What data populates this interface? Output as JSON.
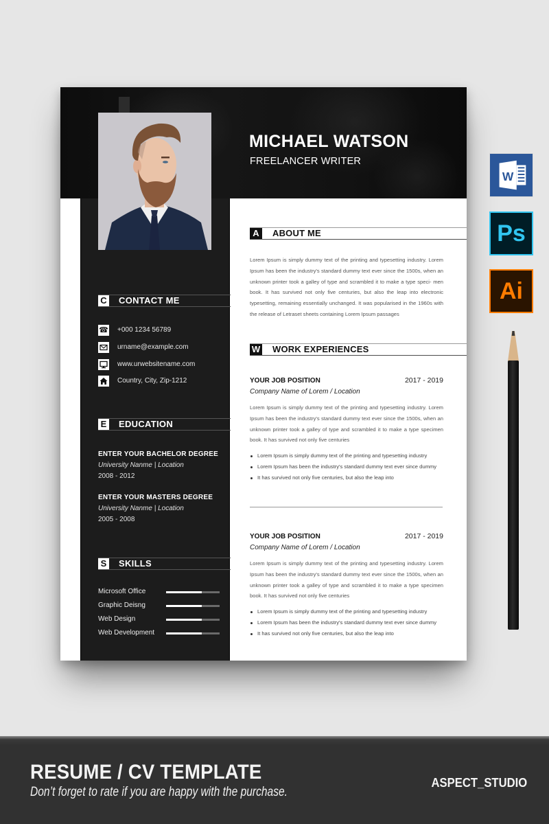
{
  "resume": {
    "name": "MICHAEL WATSON",
    "title": "FREELANCER WRITER",
    "contact": {
      "letter": "C",
      "heading": "CONTACT ME",
      "items": [
        {
          "icon": "phone-icon",
          "text": "+000 1234 56789"
        },
        {
          "icon": "envelope-icon",
          "text": "urname@example.com"
        },
        {
          "icon": "monitor-icon",
          "text": "www.urwebsitename.com"
        },
        {
          "icon": "home-icon",
          "text": "Country, City, Zip-1212"
        }
      ]
    },
    "education": {
      "letter": "E",
      "heading": "EDUCATION",
      "items": [
        {
          "degree": "ENTER YOUR BACHELOR DEGREE",
          "university": "University Nanme | Location",
          "years": "2008 - 2012"
        },
        {
          "degree": "ENTER YOUR MASTERS DEGREE",
          "university": "University Nanme | Location",
          "years": "2005 - 2008"
        }
      ]
    },
    "skills": {
      "letter": "S",
      "heading": "SKILLS",
      "items": [
        {
          "name": "Microsoft Office",
          "level": 0.67
        },
        {
          "name": "Graphic Deisng",
          "level": 0.67
        },
        {
          "name": "Web Design",
          "level": 0.67
        },
        {
          "name": "Web Development",
          "level": 0.67
        }
      ]
    },
    "about": {
      "letter": "A",
      "heading": "ABOUT ME",
      "text": "Lorem Ipsum is simply dummy text of the printing and typesetting industry. Lorem Ipsum has been the industry's standard dummy text ever since the 1500s, when an unknown printer took a galley of type and scrambled it to make a type speci- men book. It has survived not only five centuries, but also the leap into electronic typesetting, remaining essentially unchanged. It was popularised in the 1960s with the release of Letraset sheets containing Lorem Ipsum passages"
    },
    "work": {
      "letter": "W",
      "heading": "WORK EXPERIENCES",
      "jobs": [
        {
          "position": "YOUR JOB POSITION",
          "years": "2017 - 2019",
          "company": "Company Name  of Lorem / Location",
          "description": "Lorem Ipsum is simply dummy text of the printing and typesetting industry. Lorem Ipsum has been the industry's standard dummy text ever since the 1500s, when an unknown printer took a galley of type and scrambled it to make a type specimen book. It has survived not only five centuries",
          "bullets": [
            "Lorem Ipsum is simply dummy text of the printing and typesetting industry",
            "Lorem Ipsum has been the industry's standard dummy text ever since dummy",
            "It has survived not only five centuries, but also the leap into"
          ]
        },
        {
          "position": "YOUR JOB POSITION",
          "years": "2017 - 2019",
          "company": "Company Name  of Lorem / Location",
          "description": "Lorem Ipsum is simply dummy text of the printing and typesetting industry. Lorem Ipsum has been the industry's standard dummy text ever since the 1500s, when an unknown printer took a galley of type and scrambled it to make a type specimen book. It has survived not only five centuries",
          "bullets": [
            "Lorem Ipsum is simply dummy text of the printing and typesetting industry",
            "Lorem Ipsum has been the industry's standard dummy text ever since dummy",
            "It has survived not only five centuries, but also the leap into"
          ]
        }
      ]
    }
  },
  "apps": [
    {
      "name": "word-icon",
      "label": "W",
      "color": "#2b579a"
    },
    {
      "name": "photoshop-icon",
      "label": "Ps",
      "color": "#31c5f0"
    },
    {
      "name": "illustrator-icon",
      "label": "Ai",
      "color": "#ff7c00"
    }
  ],
  "banner": {
    "title": "RESUME / CV TEMPLATE",
    "subtitle": "Don’t forget to rate if you are happy with the purchase.",
    "brand": "ASPECT_STUDIO"
  }
}
